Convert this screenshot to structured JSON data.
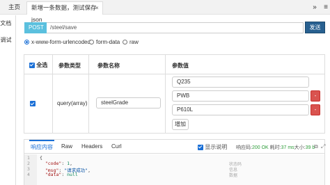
{
  "tabs": {
    "home": "主页",
    "active": "新增一条数据，测试保存json",
    "close": "×",
    "more": "»",
    "menu": "≡"
  },
  "side": {
    "item_doc": "文档",
    "item_debug": "调试"
  },
  "request": {
    "method": "POST",
    "url": "/steel/save",
    "send_label": "发送"
  },
  "content_type": {
    "options": [
      "x-www-form-urlencoded",
      "form-data",
      "raw"
    ],
    "selected": "x-www-form-urlencoded"
  },
  "params": {
    "headers": {
      "select_all": "全选",
      "type": "参数类型",
      "name": "参数名称",
      "value": "参数值"
    },
    "row": {
      "checked": true,
      "type": "query(array)",
      "name": "steelGrade",
      "values": [
        "Q235",
        "PWB",
        "P610L"
      ],
      "delete_label": "-",
      "add_label": "增加"
    }
  },
  "response": {
    "tabs": [
      "响应内容",
      "Raw",
      "Headers",
      "Curl"
    ],
    "active_tab": "响应内容",
    "show_desc": "显示说明",
    "status_label": "响应码:",
    "status_code": "200 OK",
    "time_label": "耗时:",
    "time_value": "37 ms",
    "size_label": "大小:",
    "size_value": "39 b",
    "lines": [
      {
        "num": "1",
        "text": "{"
      },
      {
        "num": "2",
        "key": "\"code\"",
        "value": "1",
        "vtype": "n",
        "note": "状态码"
      },
      {
        "num": "3",
        "key": "\"msg\"",
        "value": "\"请求成功\"",
        "vtype": "s",
        "note": "信息"
      },
      {
        "num": "4",
        "key": "\"data\"",
        "value": "null",
        "vtype": "n",
        "note": "数据"
      }
    ]
  }
}
